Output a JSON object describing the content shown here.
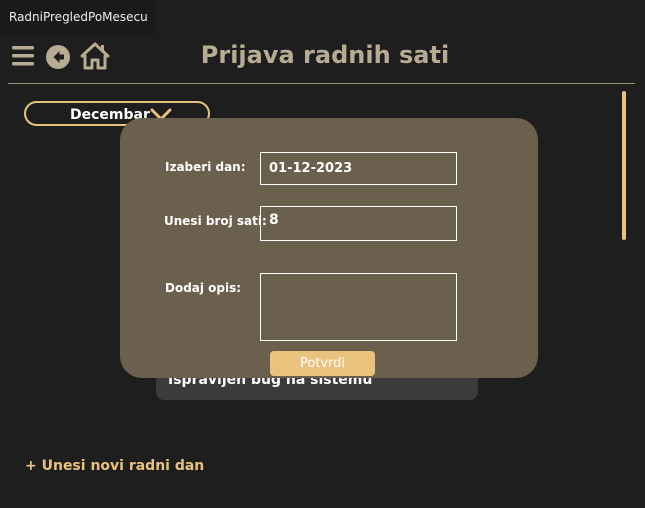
{
  "window": {
    "title": "RadniPregledPoMesecu"
  },
  "header": {
    "title": "Prijava radnih sati"
  },
  "icons": {
    "menu": "hamburger-menu-icon",
    "back": "back-arrow-icon",
    "home": "home-icon",
    "chevron": "chevron-down-icon"
  },
  "colors": {
    "accent": "#e9c37d",
    "background": "#1f1e1e",
    "modal": "#6b5f4d",
    "title": "#b8ab93"
  },
  "month_selector": {
    "selected": "Decembar"
  },
  "entries": [
    {
      "description": "Ispravljen bug na sistemu"
    }
  ],
  "add_link": "+ Unesi novi radni dan",
  "modal": {
    "day_label": "Izaberi dan:",
    "day_value": "01-12-2023",
    "hours_label": "Unesi broj sati:",
    "hours_value": "8",
    "desc_label": "Dodaj opis:",
    "desc_value": "",
    "confirm_label": "Potvrdi"
  }
}
